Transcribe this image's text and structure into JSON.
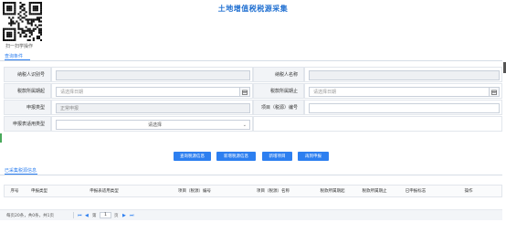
{
  "header": {
    "title": "土地增值税税源采集",
    "qr_caption": "扫一扫学操作",
    "query_tab": "查询条件"
  },
  "form": {
    "taxpayer_id_label": "纳税人识别号",
    "taxpayer_id_value": "",
    "taxpayer_name_label": "纳税人名称",
    "taxpayer_name_value": "",
    "period_start_label": "税款所属期起",
    "period_start_placeholder": "请选择日期",
    "period_end_label": "税款所属期止",
    "period_end_placeholder": "请选择日期",
    "declare_type_label": "申报类型",
    "declare_type_value": "正常申报",
    "project_no_label": "项目（税源）编号",
    "project_no_value": "",
    "applicable_type_label": "申报表适用类型",
    "applicable_type_value": "请选择"
  },
  "actions": {
    "query": "查询税源信息",
    "add": "新增税源信息",
    "add_project": "新增项目",
    "reapply": "再到申报"
  },
  "results": {
    "tab": "已采集税源信息",
    "columns": [
      "序号",
      "申报类型",
      "申报表适用类型",
      "项目（税源）编号",
      "项目（税源）名称",
      "税款所属期起",
      "税款所属期止",
      "已申报标志",
      "操作"
    ]
  },
  "pager": {
    "summary": "每页20条，共0条，共1页",
    "page_prefix": "第",
    "page_value": "1",
    "page_suffix": "页"
  },
  "colors": {
    "accent": "#2d7ff0",
    "title": "#1f6fd1",
    "label_bg": "#f2f4f7"
  }
}
